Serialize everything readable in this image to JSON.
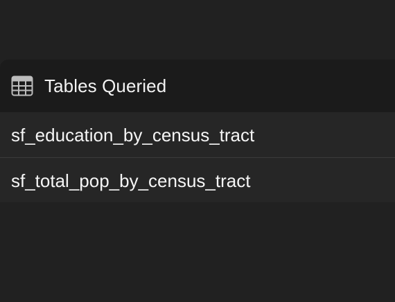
{
  "panel": {
    "icon": "table-grid-icon",
    "title": "Tables Queried",
    "tables": [
      {
        "name": "sf_education_by_census_tract"
      },
      {
        "name": "sf_total_pop_by_census_tract"
      }
    ]
  },
  "colors": {
    "background": "#212121",
    "panel_background": "#1b1b1b",
    "row_background": "#262626",
    "divider": "#3a3a3a",
    "text": "#f5f5f5",
    "icon": "#bdbdbd"
  }
}
